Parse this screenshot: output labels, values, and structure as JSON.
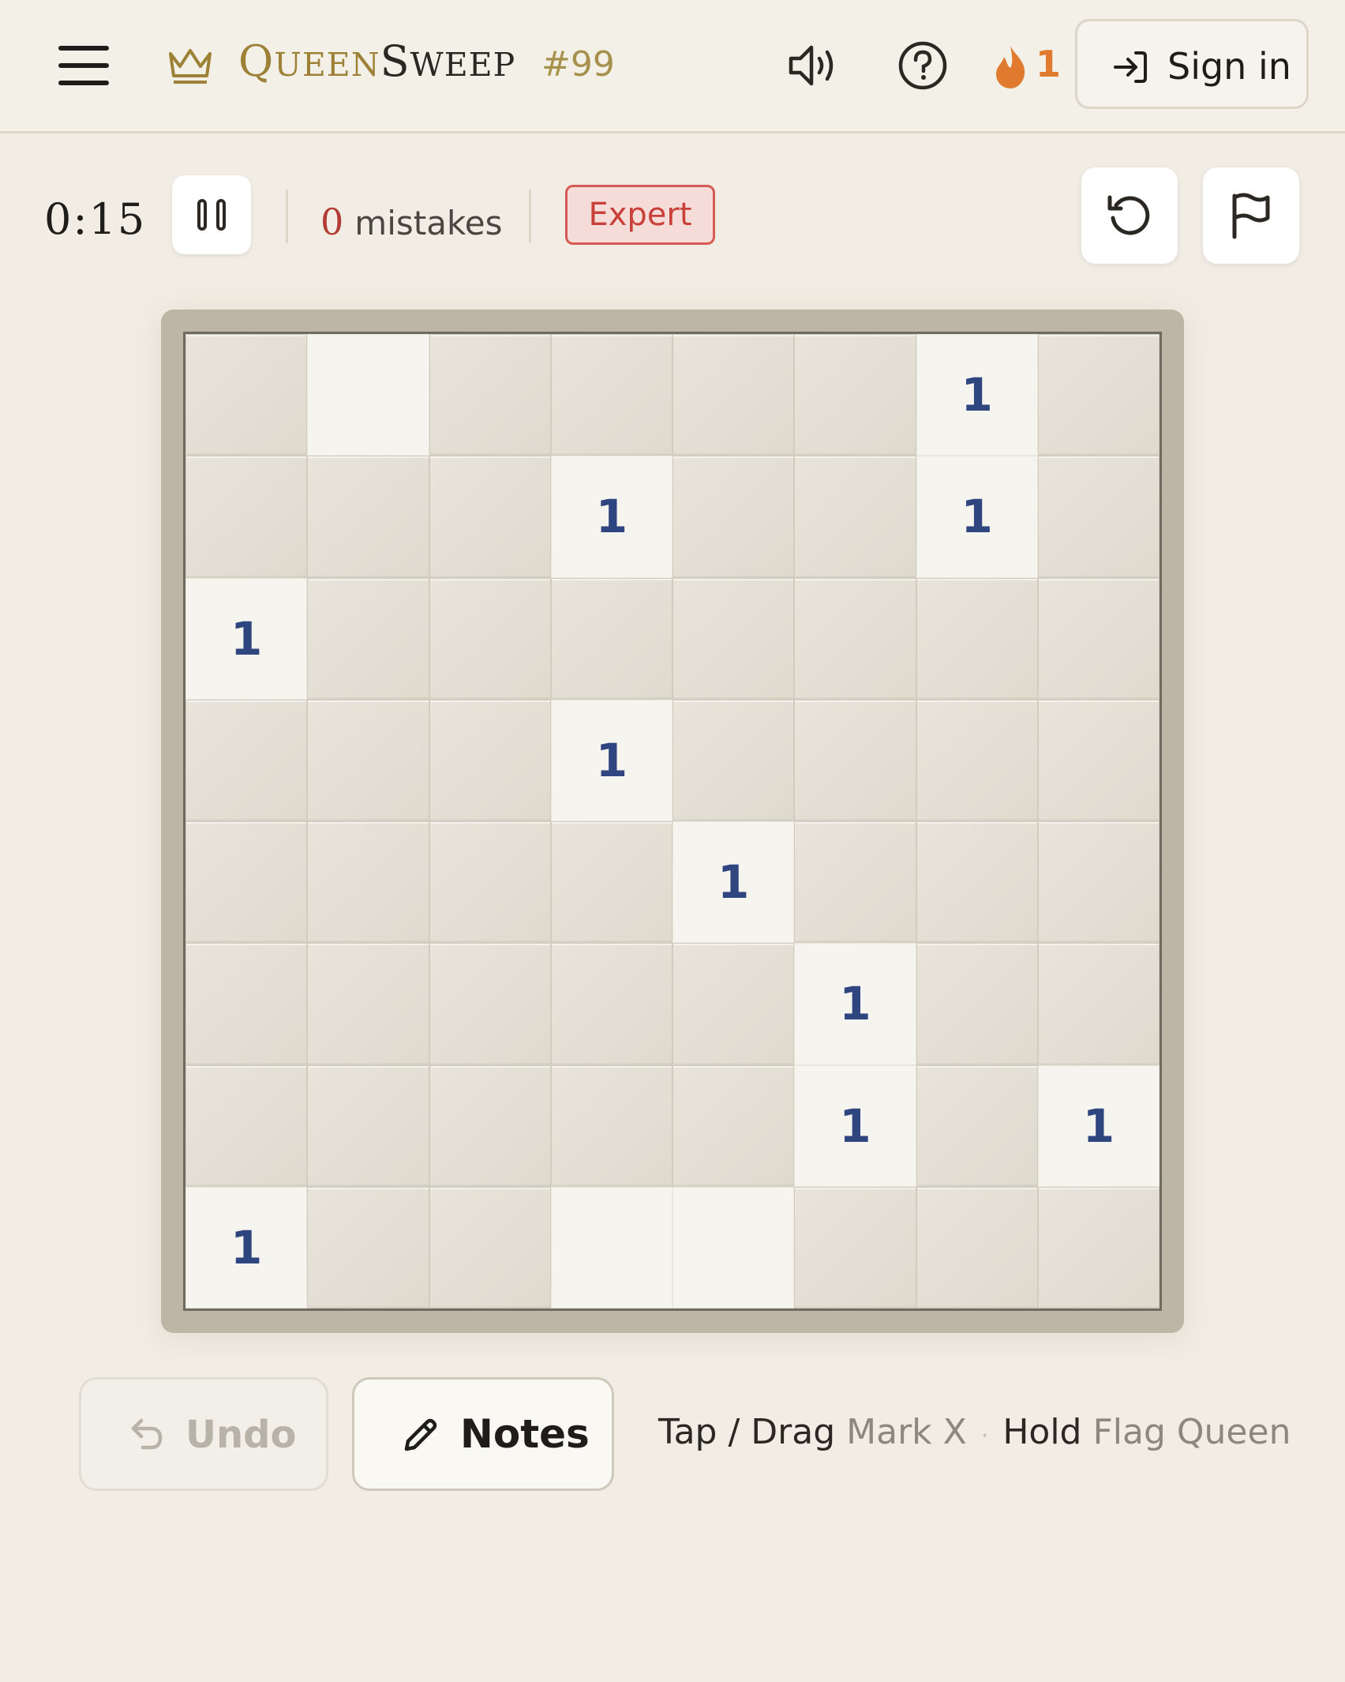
{
  "header": {
    "logo_first_cap": "Q",
    "logo_first_rest": "UEEN",
    "logo_second_cap": "S",
    "logo_second_rest": "WEEP",
    "puzzle_number": "#99",
    "streak_count": "1",
    "signin_label": "Sign in",
    "icons": [
      "menu-icon",
      "crown-icon",
      "sound-icon",
      "help-icon",
      "flame-icon",
      "sign-in-icon"
    ]
  },
  "status": {
    "timer": "0:15",
    "mistakes_count": "0",
    "mistakes_label": "mistakes",
    "difficulty": "Expert",
    "icons": [
      "pause-icon",
      "restart-icon",
      "flag-icon"
    ]
  },
  "board": {
    "rows": 8,
    "cols": 8,
    "cells": [
      [
        "",
        "rev",
        "",
        "",
        "",
        "",
        "1",
        ""
      ],
      [
        "",
        "",
        "",
        "1",
        "",
        "",
        "1",
        ""
      ],
      [
        "1",
        "",
        "",
        "",
        "",
        "",
        "",
        ""
      ],
      [
        "",
        "",
        "",
        "1",
        "",
        "",
        "",
        ""
      ],
      [
        "",
        "",
        "",
        "",
        "1",
        "",
        "",
        ""
      ],
      [
        "",
        "",
        "",
        "",
        "",
        "1",
        "",
        ""
      ],
      [
        "",
        "",
        "",
        "",
        "",
        "1",
        "",
        "1"
      ],
      [
        "1",
        "",
        "",
        "rev",
        "rev",
        "",
        "",
        ""
      ]
    ]
  },
  "controls": {
    "undo_label": "Undo",
    "notes_label": "Notes",
    "hint_tap": "Tap / Drag",
    "hint_tap_action": "Mark X",
    "hint_sep": "·",
    "hint_hold": "Hold",
    "hint_hold_action": "Flag Queen"
  },
  "colors": {
    "accent_gold": "#9c8136",
    "number_blue": "#2e4580",
    "danger": "#c9403a",
    "streak": "#e07a2e"
  }
}
